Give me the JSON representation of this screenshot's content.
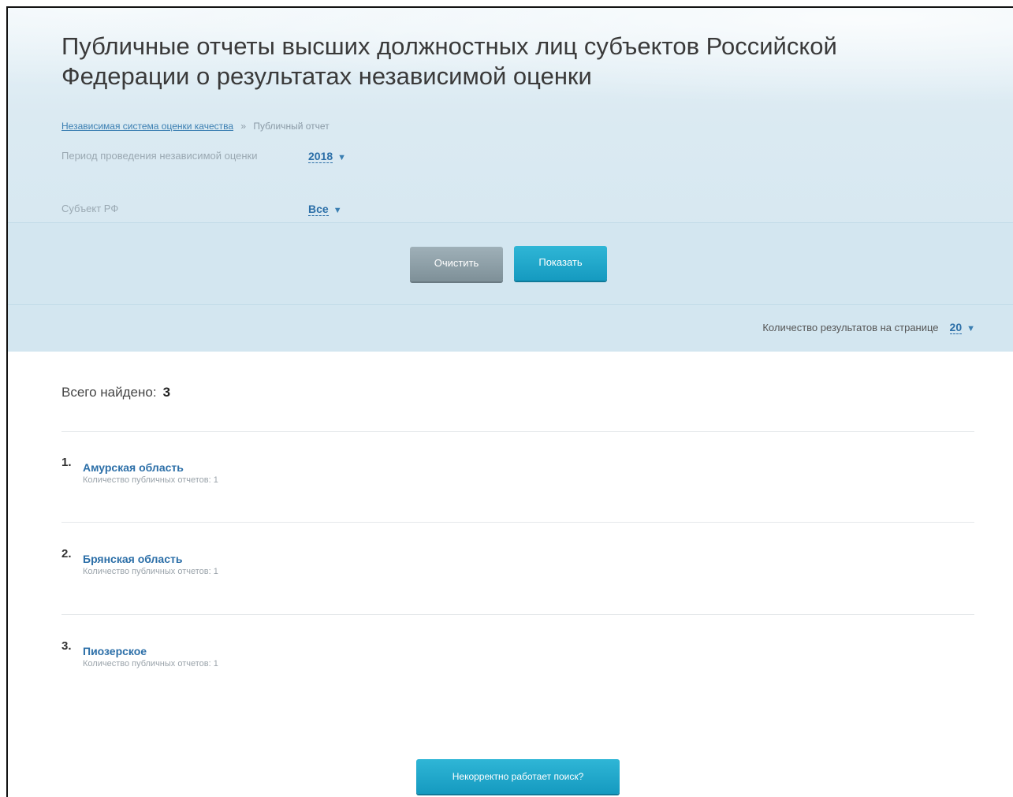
{
  "header": {
    "title": "Публичные отчеты высших должностных лиц субъектов Российской Федерации о результатах независимой оценки"
  },
  "breadcrumb": {
    "link": "Независимая система оценки качества",
    "separator": "»",
    "current": "Публичный отчет"
  },
  "filters": {
    "period_label": "Период проведения независимой оценки",
    "period_value": "2018",
    "subject_label": "Субъект РФ",
    "subject_value": "Все",
    "dropdown_arrow": "▼"
  },
  "buttons": {
    "clear": "Очистить",
    "show": "Показать",
    "feedback": "Некорректно работает поиск?"
  },
  "pagination": {
    "per_page_label": "Количество результатов на странице",
    "per_page_value": "20"
  },
  "results": {
    "total_label": "Всего найдено:",
    "total_count": "3",
    "items": [
      {
        "num": "1.",
        "name": "Амурская область",
        "sub": "Количество публичных отчетов: 1"
      },
      {
        "num": "2.",
        "name": "Брянская область",
        "sub": "Количество публичных отчетов: 1"
      },
      {
        "num": "3.",
        "name": "Пиозерское",
        "sub": "Количество публичных отчетов: 1"
      }
    ]
  }
}
